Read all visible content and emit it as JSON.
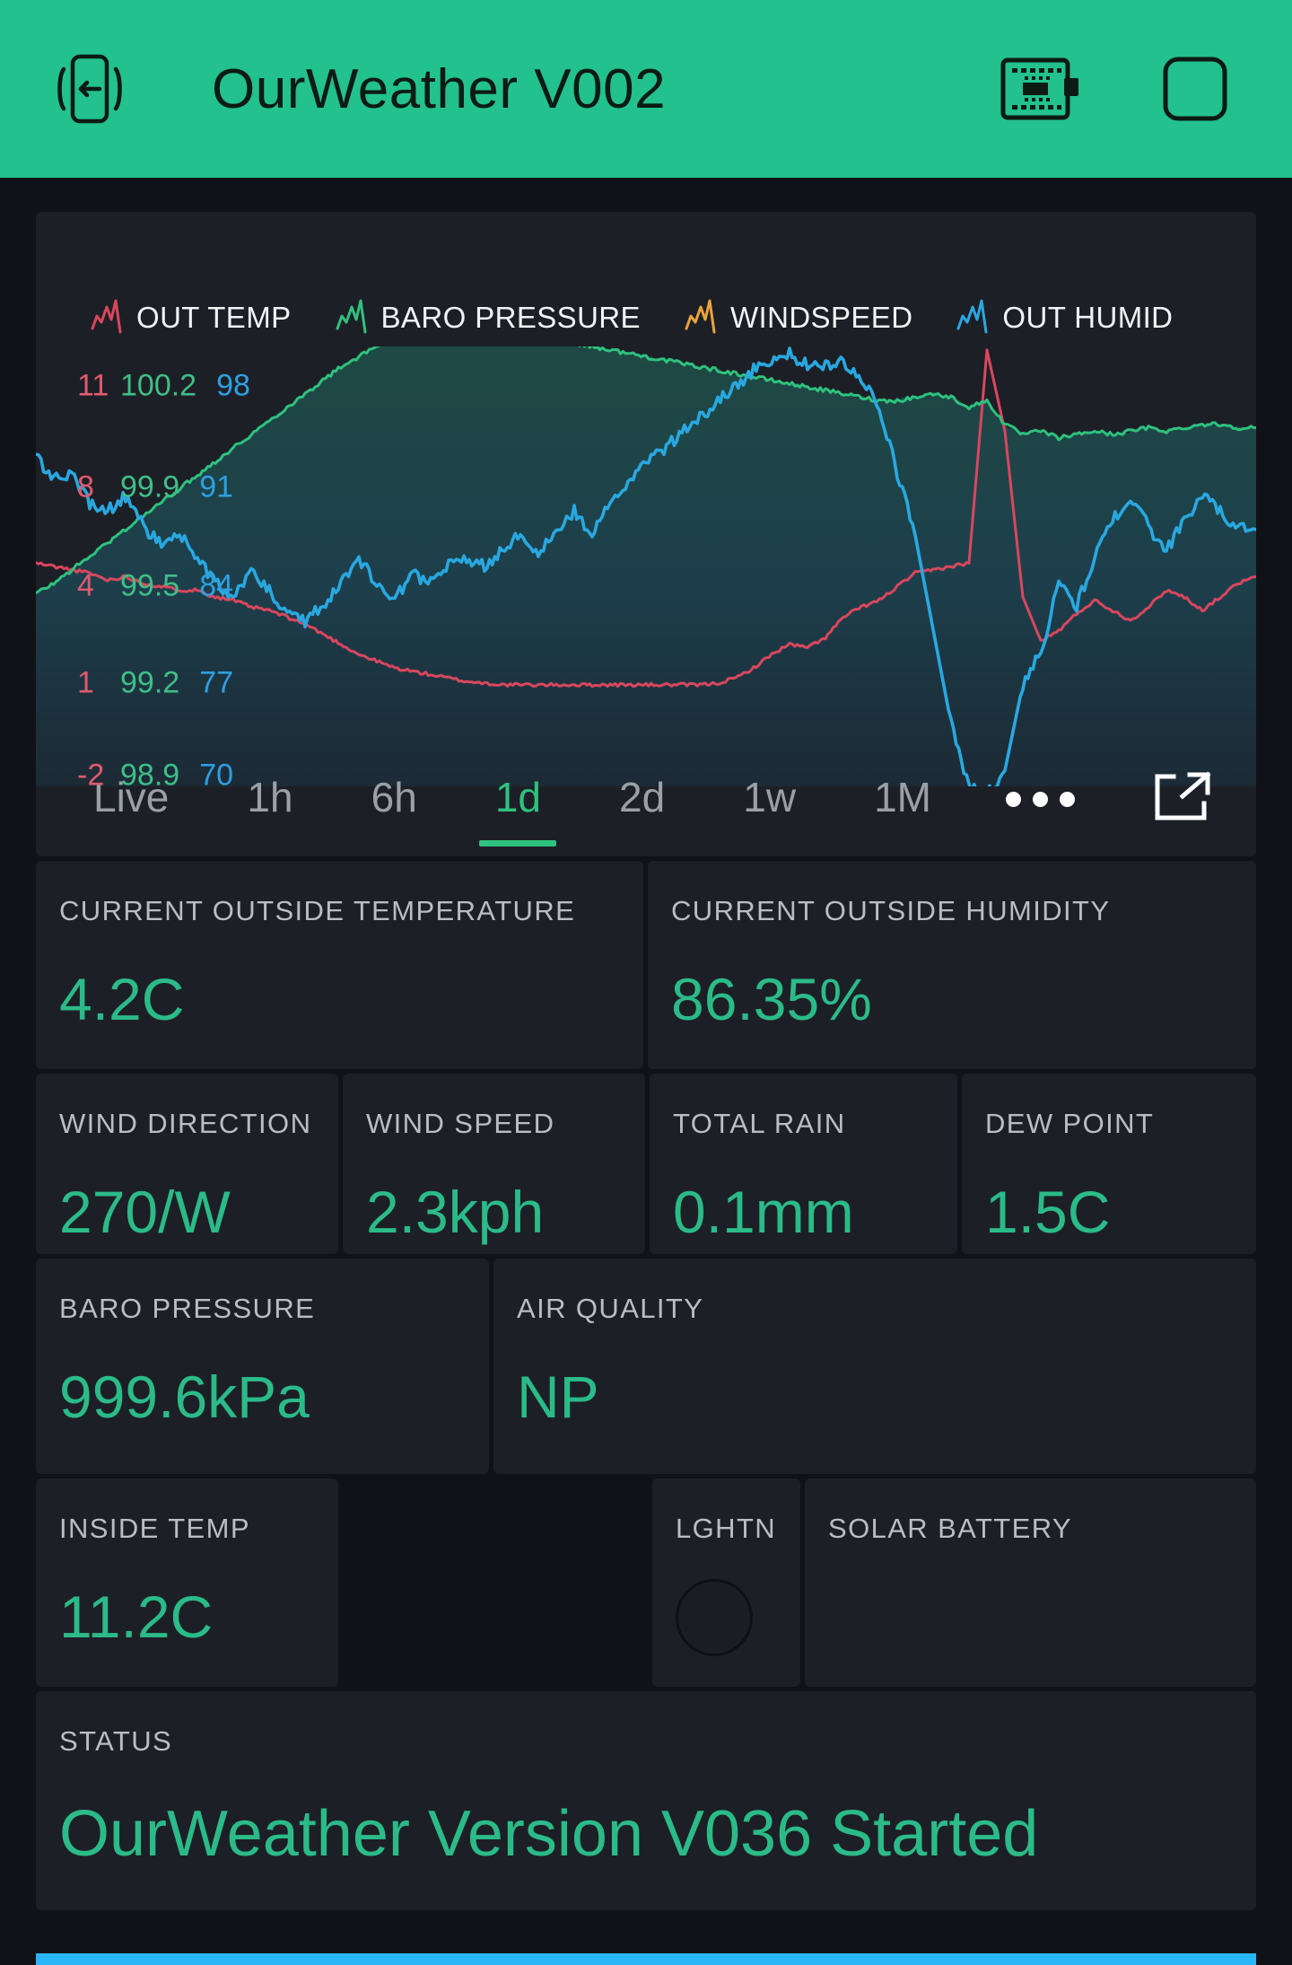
{
  "header": {
    "title": "OurWeather V002",
    "back_icon": "phone-back-icon",
    "board_icon": "circuit-board-icon",
    "square_icon": "rounded-square-icon"
  },
  "chart": {
    "legend": [
      {
        "label": "OUT TEMP",
        "color": "#d9475e",
        "icon": "sparkline-icon"
      },
      {
        "label": "BARO PRESSURE",
        "color": "#2ec27e",
        "icon": "sparkline-icon"
      },
      {
        "label": "WINDSPEED",
        "color": "#e8a33d",
        "icon": "sparkline-icon"
      },
      {
        "label": "OUT HUMID",
        "color": "#29a8e0",
        "icon": "sparkline-icon"
      }
    ],
    "axis_temp": [
      "11",
      "8",
      "4",
      "1",
      "-2"
    ],
    "axis_baro": [
      "100.2",
      "99.9",
      "99.5",
      "99.2",
      "98.9"
    ],
    "axis_humid": [
      "98",
      "91",
      "84",
      "77",
      "70"
    ],
    "tabs": [
      {
        "label": "Live",
        "active": false
      },
      {
        "label": "1h",
        "active": false
      },
      {
        "label": "6h",
        "active": false
      },
      {
        "label": "1d",
        "active": true
      },
      {
        "label": "2d",
        "active": false
      },
      {
        "label": "1w",
        "active": false
      },
      {
        "label": "1M",
        "active": false
      }
    ],
    "more_icon": "ellipsis-icon",
    "expand_icon": "open-external-icon"
  },
  "chart_data": {
    "type": "line",
    "title": "",
    "xlabel": "",
    "ylabel": "",
    "grid": false,
    "legend_position": "top-left",
    "axes": [
      {
        "name": "OUT TEMP",
        "unit": "C",
        "ticks": [
          11,
          8,
          4,
          1,
          -2
        ],
        "ylim": [
          -2,
          11
        ],
        "color": "#d9475e"
      },
      {
        "name": "BARO PRESSURE",
        "unit": "kPa",
        "ticks": [
          100.2,
          99.9,
          99.5,
          99.2,
          98.9
        ],
        "ylim": [
          98.9,
          100.2
        ],
        "color": "#2ec27e"
      },
      {
        "name": "OUT HUMID",
        "unit": "%",
        "ticks": [
          98,
          91,
          84,
          77,
          70
        ],
        "ylim": [
          70,
          98
        ],
        "color": "#29a8e0"
      }
    ],
    "series": [
      {
        "name": "OUT TEMP",
        "color": "#d9475e",
        "axis": "OUT TEMP",
        "values": [
          4.6,
          4.5,
          4.4,
          4.3,
          4.1,
          4.2,
          4.0,
          3.9,
          3.8,
          3.8,
          3.6,
          3.5,
          3.3,
          3.2,
          3.0,
          2.8,
          2.5,
          2.2,
          1.9,
          1.7,
          1.5,
          1.4,
          1.3,
          1.2,
          1.1,
          1.05,
          1.0,
          1.0,
          1.0,
          1.0,
          1.0,
          1.0,
          1.0,
          1.0,
          1.0,
          1.0,
          1.0,
          1.0,
          1.05,
          1.2,
          1.5,
          1.9,
          2.2,
          2.1,
          2.4,
          3.0,
          3.3,
          3.5,
          3.9,
          4.3,
          4.4,
          4.5,
          4.6,
          10.9,
          8.5,
          3.6,
          2.3,
          2.6,
          3.1,
          3.5,
          3.2,
          2.9,
          3.3,
          3.8,
          3.6,
          3.2,
          3.6,
          4.0,
          4.2
        ]
      },
      {
        "name": "BARO PRESSURE",
        "color": "#2ec27e",
        "axis": "BARO PRESSURE",
        "values": [
          99.47,
          99.5,
          99.54,
          99.58,
          99.62,
          99.66,
          99.7,
          99.74,
          99.78,
          99.82,
          99.86,
          99.9,
          99.94,
          99.98,
          100.02,
          100.06,
          100.1,
          100.14,
          100.17,
          100.2,
          100.22,
          100.24,
          100.25,
          100.26,
          100.26,
          100.26,
          100.25,
          100.24,
          100.23,
          100.22,
          100.21,
          100.2,
          100.19,
          100.18,
          100.17,
          100.16,
          100.15,
          100.14,
          100.13,
          100.12,
          100.11,
          100.1,
          100.09,
          100.08,
          100.07,
          100.06,
          100.05,
          100.04,
          100.04,
          100.05,
          100.06,
          100.05,
          100.02,
          100.04,
          99.97,
          99.94,
          99.95,
          99.93,
          99.94,
          99.95,
          99.94,
          99.95,
          99.96,
          99.95,
          99.96,
          99.97,
          99.97,
          99.96,
          99.96
        ]
      },
      {
        "name": "OUT HUMID",
        "color": "#29a8e0",
        "axis": "OUT HUMID",
        "values": [
          91.0,
          89.5,
          90.0,
          88.0,
          87.5,
          88.5,
          86.5,
          85.5,
          86.0,
          84.5,
          83.0,
          82.0,
          83.5,
          82.5,
          81.0,
          80.5,
          81.5,
          83.0,
          84.5,
          83.0,
          82.0,
          83.5,
          83.0,
          84.0,
          84.5,
          84.0,
          85.0,
          86.0,
          85.0,
          86.0,
          87.5,
          86.0,
          88.0,
          89.5,
          90.5,
          91.5,
          92.5,
          93.5,
          94.5,
          95.5,
          96.5,
          97.2,
          97.5,
          96.8,
          96.9,
          97.0,
          96.0,
          94.0,
          90.0,
          86.0,
          80.0,
          74.0,
          70.0,
          69.5,
          71.0,
          76.5,
          78.5,
          83.0,
          81.5,
          84.5,
          87.0,
          88.5,
          86.5,
          85.0,
          87.0,
          88.5,
          87.5,
          86.4,
          86.35
        ]
      }
    ],
    "annotations": [
      "sharp spike in OUT TEMP and sharp drop in OUT HUMID near the right edge"
    ]
  },
  "stats": {
    "outside_temperature": {
      "label": "CURRENT OUTSIDE TEMPERATURE",
      "value": "4.2C"
    },
    "outside_humidity": {
      "label": "CURRENT OUTSIDE HUMIDITY",
      "value": "86.35%"
    },
    "wind_direction": {
      "label": "WIND DIRECTION",
      "value": "270/W"
    },
    "wind_speed": {
      "label": "WIND SPEED",
      "value": "2.3kph"
    },
    "total_rain": {
      "label": "TOTAL RAIN",
      "value": "0.1mm"
    },
    "dew_point": {
      "label": "DEW POINT",
      "value": "1.5C"
    },
    "baro_pressure": {
      "label": "BARO PRESSURE",
      "value": "999.6kPa"
    },
    "air_quality": {
      "label": "AIR QUALITY",
      "value": "NP"
    },
    "inside_temp": {
      "label": "INSIDE TEMP",
      "value": "11.2C"
    },
    "lightning": {
      "label": "LGHTN",
      "value": ""
    },
    "solar_battery": {
      "label": "SOLAR BATTERY",
      "value": ""
    }
  },
  "status": {
    "label": "STATUS",
    "value": "OurWeather Version V036 Started"
  },
  "colors": {
    "header_green": "#22c18d",
    "value_green": "#2bbb88",
    "accent_cyan": "#29b6f6",
    "card_bg": "#1d1f26",
    "page_bg": "#111217"
  }
}
